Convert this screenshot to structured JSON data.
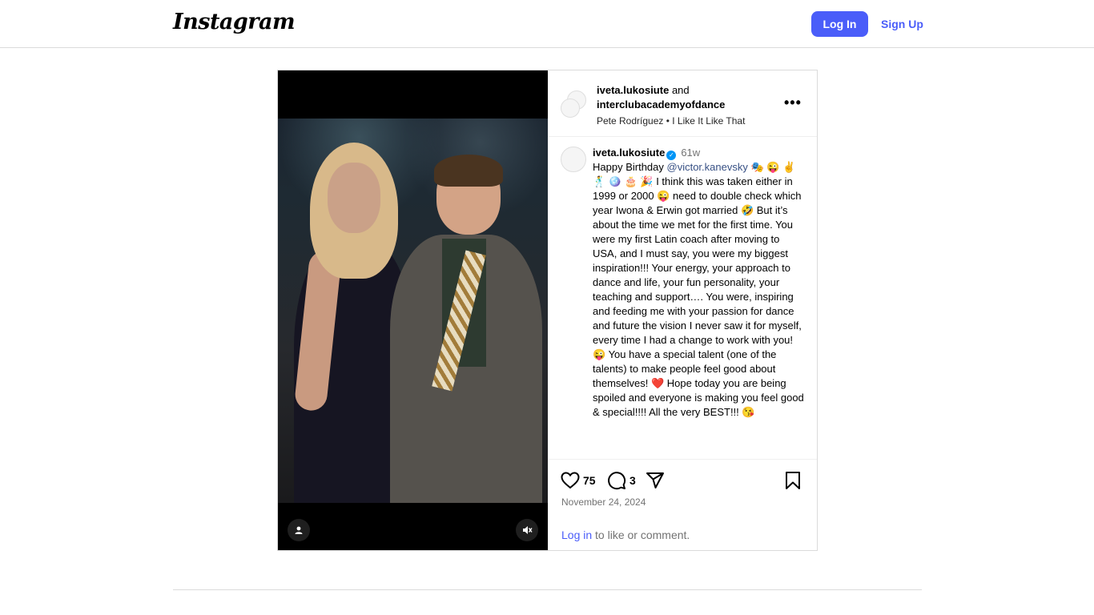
{
  "header": {
    "logo": "Instagram",
    "login_label": "Log In",
    "signup_label": "Sign Up",
    "accent": "#4a5df9"
  },
  "post": {
    "author": "iveta.lukosiute",
    "and_text": "and",
    "collaborator": "interclubacademyofdance",
    "audio": "Pete Rodríguez • I Like It Like That",
    "more_icon": "more-horizontal-icon",
    "caption": {
      "user": "iveta.lukosiute",
      "time": "61w",
      "prefix": "Happy Birthday ",
      "mention": "@victor.kanevsky",
      "text": " 🎭 😜 ✌️ 🕺 🪩 🎂 🎉 I think this was taken either in 1999 or 2000 😜 need to double check which year Iwona & Erwin got married 🤣 But it’s about the time we met for the first time. You were my first Latin coach after moving to USA, and I must say, you were my biggest inspiration!!! Your energy, your approach to dance and life, your fun personality, your teaching and support…. You were, inspiring and feeding me with your passion for dance and future the vision I never saw it for myself, every time I had a change to work with you! 😜 You have a special talent (one of the talents) to make people feel good about themselves! ❤️ Hope today you are being spoiled and everyone is making you feel good & special!!!! All the very BEST!!! 😘"
    },
    "likes": "75",
    "comments": "3",
    "date": "November 24, 2024",
    "login_prompt_link": "Log in",
    "login_prompt_text": " to like or comment."
  }
}
